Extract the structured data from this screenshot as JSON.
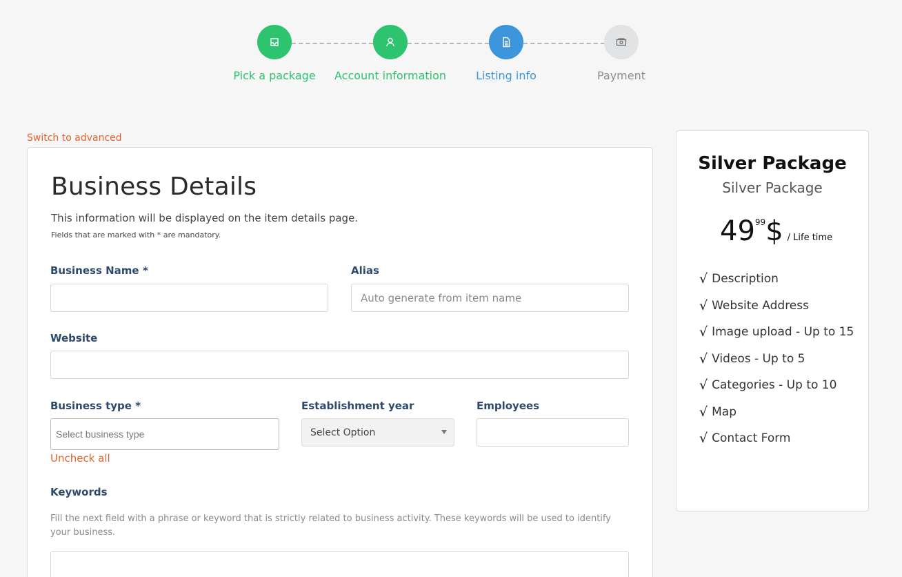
{
  "stepper": {
    "steps": [
      {
        "label": "Pick a package",
        "icon": "inbox-icon",
        "state": "done"
      },
      {
        "label": "Account information",
        "icon": "user-icon",
        "state": "done"
      },
      {
        "label": "Listing info",
        "icon": "document-icon",
        "state": "active"
      },
      {
        "label": "Payment",
        "icon": "money-icon",
        "state": "pending"
      }
    ],
    "colors": {
      "done": "#2ec36f",
      "active": "#3d96dc",
      "pending": "#e2e3e4"
    }
  },
  "form": {
    "switch_link": "Switch to advanced",
    "title": "Business Details",
    "description": "This information will be displayed on the item details page.",
    "mandatory_note": "Fields that are marked with * are mandatory.",
    "business_name": {
      "label": "Business Name  *",
      "value": ""
    },
    "alias": {
      "label": "Alias",
      "placeholder": "Auto generate from item name"
    },
    "website": {
      "label": "Website",
      "value": ""
    },
    "business_type": {
      "label": "Business type  *",
      "placeholder": "Select business type"
    },
    "uncheck_all": "Uncheck all",
    "establishment_year": {
      "label": "Establishment year",
      "selected": "Select Option"
    },
    "employees": {
      "label": "Employees",
      "value": ""
    },
    "keywords": {
      "label": "Keywords",
      "help": "Fill the next field with a phrase or keyword that is strictly related to business activity. These keywords will be used to identify your business."
    }
  },
  "package": {
    "title": "Silver Package",
    "subtitle": "Silver Package",
    "price_whole": "49",
    "price_cents": "99",
    "currency": "$",
    "period": "/ Life time",
    "check": "√",
    "features": [
      "Description",
      "Website Address",
      "Image upload - Up to 15",
      "Videos - Up to 5",
      "Categories - Up to 10",
      "Map",
      "Contact Form"
    ]
  },
  "accent_color": "#e2632c",
  "label_color": "#2d4a6b"
}
